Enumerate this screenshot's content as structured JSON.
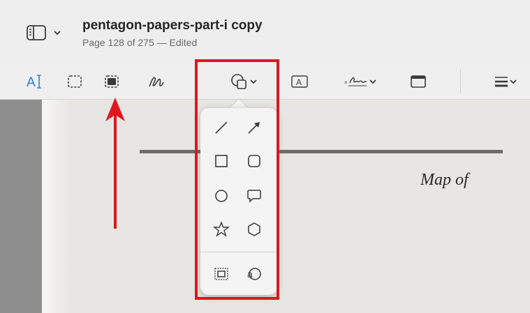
{
  "window": {
    "title": "pentagon-papers-part-i copy",
    "subtitle": "Page 128 of 275 — Edited"
  },
  "toolbar": {
    "items": [
      {
        "name": "text-selection-tool",
        "icon": "text-cursor-icon",
        "label": "A"
      },
      {
        "name": "rectangular-selection-tool",
        "icon": "dashed-rectangle-icon"
      },
      {
        "name": "redact-tool",
        "icon": "filled-rectangle-icon"
      },
      {
        "name": "sketch-tool",
        "icon": "sketch-pen-icon"
      },
      {
        "name": "shapes-tool",
        "icon": "shapes-icon"
      },
      {
        "name": "text-box-tool",
        "icon": "text-box-icon",
        "label": "A"
      },
      {
        "name": "sign-tool",
        "icon": "signature-icon"
      },
      {
        "name": "note-tool",
        "icon": "note-icon"
      },
      {
        "name": "shape-style-tool",
        "icon": "line-style-icon"
      }
    ]
  },
  "shapes_popover": {
    "shapes": [
      "line",
      "arrow",
      "rectangle",
      "rounded-rectangle",
      "oval",
      "speech-bubble",
      "star",
      "polygon"
    ],
    "tools": [
      "mask",
      "loupe"
    ]
  },
  "document": {
    "visible_text": "Map of"
  },
  "annotation_colors": {
    "highlight": "#e0161e",
    "arrow": "#e0161e"
  }
}
